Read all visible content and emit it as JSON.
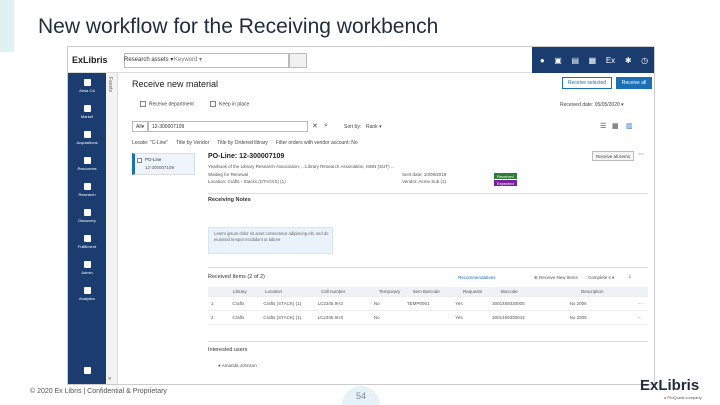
{
  "slide": {
    "title": "New workflow for the Receiving workbench",
    "footer": "© 2020 Ex Libris | Confidential & Proprietary",
    "page_number": "54",
    "brand": "ExLibris",
    "brand_sub": "a ProQuest company",
    "accent_color": "#1a3c6e"
  },
  "app": {
    "logo": "ExLibris",
    "search_scope": "Research assets",
    "search_field": "Keyword",
    "top_icons": [
      "map-marker-icon",
      "cart-icon",
      "chart-icon",
      "calendar-icon",
      "ex-icon",
      "gear-icon",
      "help-icon"
    ],
    "nav": [
      {
        "label": "Alma CA",
        "icon": "home-icon"
      },
      {
        "label": "Market",
        "icon": "market-icon"
      },
      {
        "label": "Acquisitions",
        "icon": "acquisitions-icon"
      },
      {
        "label": "Resources",
        "icon": "resources-icon"
      },
      {
        "label": "Research",
        "icon": "research-icon"
      },
      {
        "label": "Discovery",
        "icon": "discovery-icon"
      },
      {
        "label": "Fulfillment",
        "icon": "fulfillment-icon"
      },
      {
        "label": "Admin",
        "icon": "admin-icon"
      },
      {
        "label": "Analytics",
        "icon": "analytics-icon"
      }
    ],
    "facets_label": "Facets",
    "page_heading": "Receive new material",
    "btn_receive_selected": "Receive selected",
    "btn_receive_all": "Receive all",
    "receive_department_label": "Receive department",
    "keep_in_place_label": "Keep in place",
    "received_date": "Received date: 05/05/2020",
    "search_type": "All",
    "search_value": "12-300007109",
    "sort_label": "Sort by:",
    "sort_value": "Rank",
    "filters": [
      "Locate: \"C-Line\"",
      "Title by Vendor",
      "Title by Ordered library",
      "Filter orders with vendor account: No"
    ],
    "left_item_line1": "PO-Line",
    "left_item_line2": "12-300007109",
    "po_line_title": "PO-Line: 12-300007109",
    "btn_receive_all_items": "Receive all items",
    "desc_line": "Yearbook of the Library Research Association, ...Library Research Association, ISBN (SUT) ...",
    "waiting_label": "Waiting for Renewal",
    "location_line": "Location: Crafts - Stacks (STACKS) (1)",
    "date_line": "Sent date: 10/09/2019",
    "vendor_line": "Vendor: Acme Sub (1)",
    "badge_received": "Received",
    "badge_expected": "Expected",
    "receiving_notes_label": "Receiving Notes",
    "notes_text": "Lorem ipsum dolor sit amet consectetur adipiscing elit, sed do eiusmod tempor incididunt ut labore",
    "received_items_label": "Received Items (2 of 2)",
    "recommendations_label": "Recommendations",
    "receive_new_items_label": "Receive New Items",
    "complete_label": "Complete it",
    "table": {
      "headers": [
        "",
        "Library",
        "Location",
        "Call number",
        "Temporary",
        "Item Barcode",
        "Requests",
        "Barcode",
        "Description"
      ],
      "rows": [
        [
          "1",
          "Crafts",
          "Crafts (STACK) (1)",
          "LC2345.9H3",
          "No",
          "TEMP0001",
          "Yes",
          "3001459330005",
          "No 2006"
        ],
        [
          "2",
          "Crafts",
          "Crafts (STACK) (1)",
          "LC2345.9H3",
          "No",
          "",
          "Yes",
          "3001459330043",
          "No 2005"
        ]
      ]
    },
    "interested_users_label": "Interested users",
    "user_name": "Amanda Johnson"
  }
}
